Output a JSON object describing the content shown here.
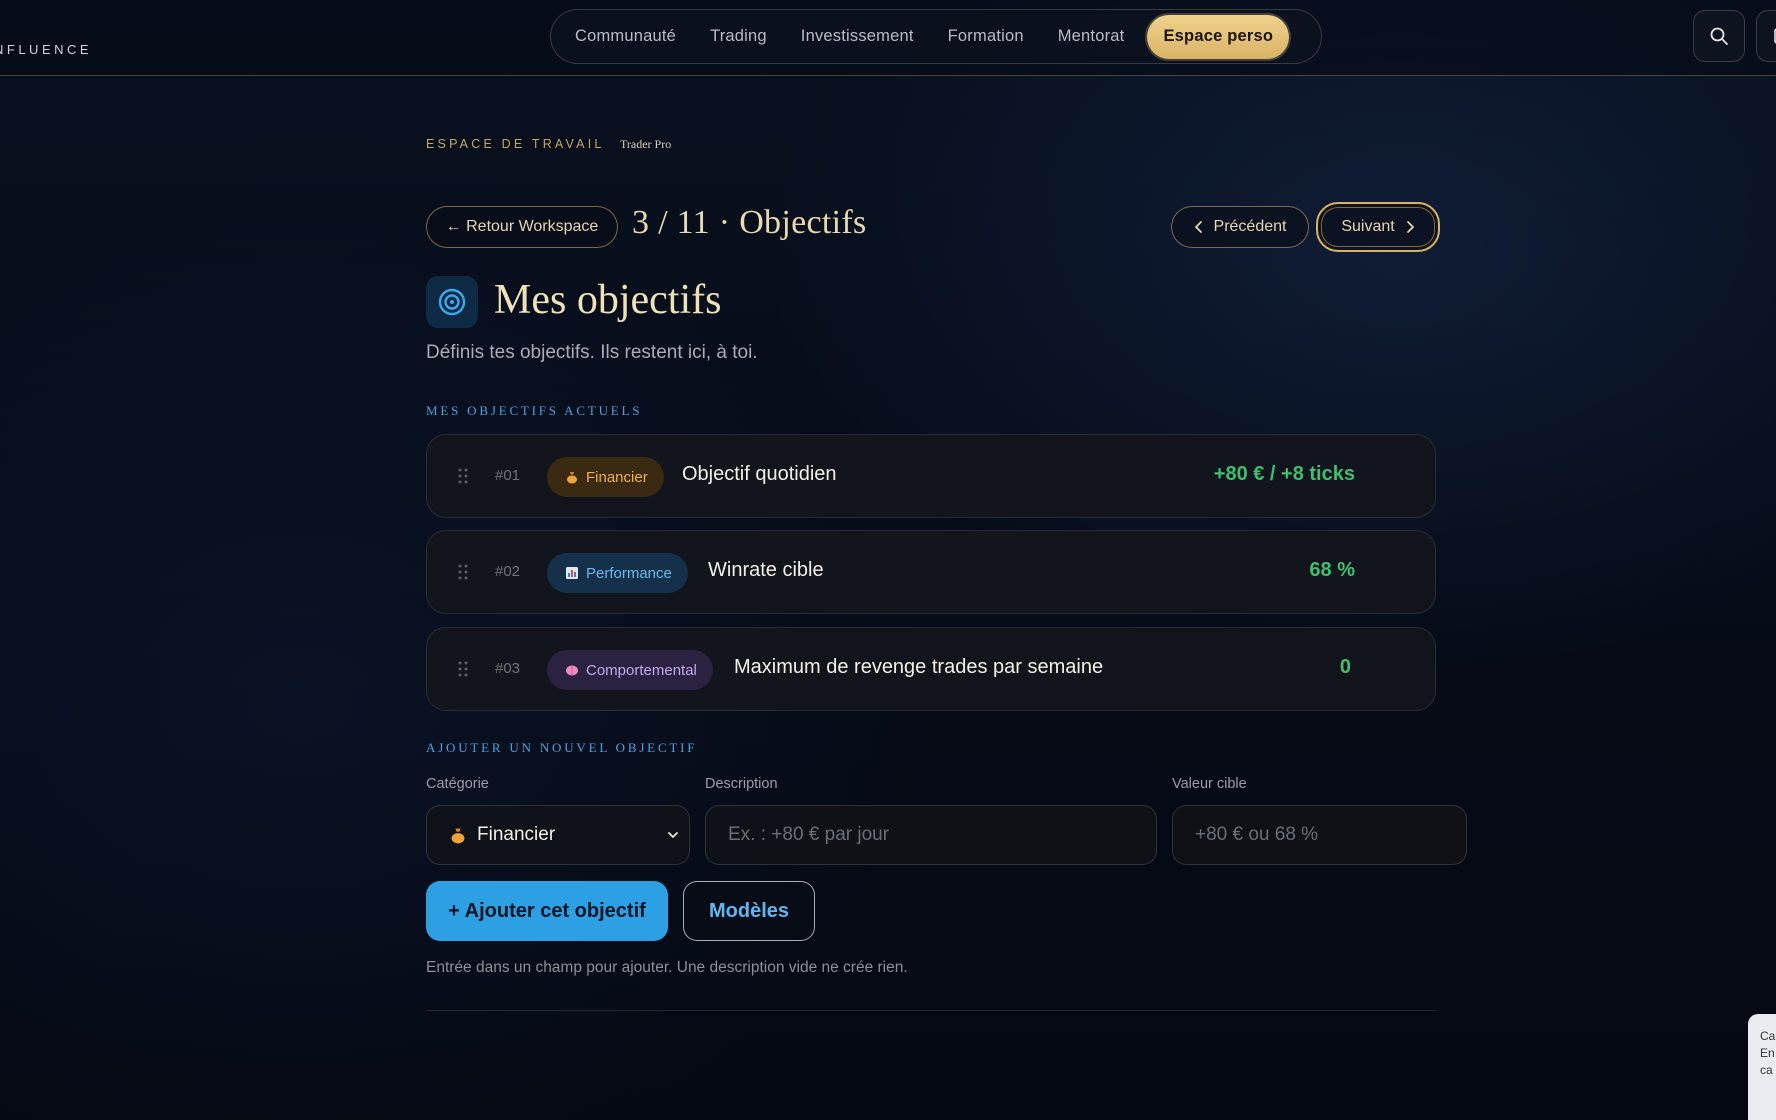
{
  "header": {
    "brand": "NFLUENCE",
    "nav": [
      {
        "label": "Communauté"
      },
      {
        "label": "Trading"
      },
      {
        "label": "Investissement"
      },
      {
        "label": "Formation"
      },
      {
        "label": "Mentorat"
      },
      {
        "label": "Espace perso",
        "active": true
      }
    ],
    "icons": [
      "search-icon",
      "panel-icon"
    ]
  },
  "workspace": {
    "eyebrow": "ESPACE DE TRAVAIL",
    "tag": "Trader Pro",
    "back_label": "← Retour Workspace",
    "step_title": "3 / 11 · Objectifs",
    "prev_label": "Précédent",
    "next_label": "Suivant"
  },
  "page": {
    "icon": "target-icon",
    "title": "Mes objectifs",
    "subtitle": "Définis tes objectifs. Ils restent ici, à toi."
  },
  "current_goals": {
    "label": "MES OBJECTIFS ACTUELS",
    "items": [
      {
        "num": "#01",
        "category": "Financier",
        "category_icon": "money-bag-icon",
        "description": "Objectif quotidien",
        "value": "+80 € / +8 ticks"
      },
      {
        "num": "#02",
        "category": "Performance",
        "category_icon": "chart-icon",
        "description": "Winrate cible",
        "value": "68 %"
      },
      {
        "num": "#03",
        "category": "Comportemental",
        "category_icon": "brain-icon",
        "description": "Maximum de revenge trades par semaine",
        "value": "0"
      }
    ]
  },
  "new_goal": {
    "label": "AJOUTER UN NOUVEL OBJECTIF",
    "category_label": "Catégorie",
    "category_value": "Financier",
    "description_label": "Description",
    "description_placeholder": "Ex. : +80 € par jour",
    "target_label": "Valeur cible",
    "target_placeholder": "+80 € ou 68 %",
    "add_label": "+ Ajouter cet objectif",
    "models_label": "Modèles",
    "hint": "Entrée dans un champ pour ajouter. Une description vide ne crée rien."
  },
  "side_card": {
    "lines": [
      "Ca",
      "En",
      "ca"
    ]
  },
  "colors": {
    "gold": "#d9b365",
    "accent_blue": "#2d9fe3",
    "value_green": "#3fbf6f"
  }
}
